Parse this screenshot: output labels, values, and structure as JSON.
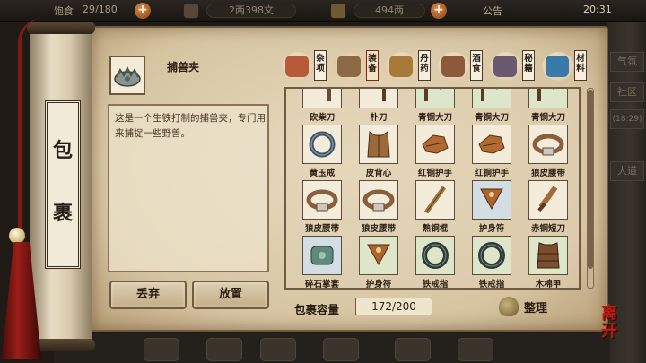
{
  "topbar": {
    "food_label": "饱食",
    "food_value": "29/180",
    "copper": "2两398文",
    "silver": "494两",
    "announcement": "公告",
    "time": "20:31"
  },
  "scroll": {
    "char1": "包",
    "char2": "裹"
  },
  "side_labels": [
    "气氛",
    "社区",
    "(18:29)",
    "大道"
  ],
  "selected_item": {
    "name": "捕兽夹",
    "description": "这是一个生铁打制的捕兽夹，专门用来捕捉一些野兽。"
  },
  "actions": {
    "discard": "丢弃",
    "place": "放置"
  },
  "tabs": [
    {
      "label": "杂项",
      "icon": "misc-pot-icon",
      "active": false
    },
    {
      "label": "装备",
      "icon": "equipment-icon",
      "active": true
    },
    {
      "label": "丹药",
      "icon": "pill-icon",
      "active": false
    },
    {
      "label": "酒食",
      "icon": "wine-food-icon",
      "active": false
    },
    {
      "label": "秘籍",
      "icon": "manual-books-icon",
      "active": false
    },
    {
      "label": "材料",
      "icon": "material-crystal-icon",
      "active": false
    }
  ],
  "items": [
    {
      "label": "砍柴刀",
      "icon": "chopping-knife-icon",
      "tier": "common"
    },
    {
      "label": "朴刀",
      "icon": "broadsword-icon",
      "tier": "common"
    },
    {
      "label": "青铜大刀",
      "icon": "bronze-blade-icon",
      "tier": "uncommon"
    },
    {
      "label": "青铜大刀",
      "icon": "bronze-blade-icon",
      "tier": "uncommon"
    },
    {
      "label": "青铜大刀",
      "icon": "bronze-blade-icon",
      "tier": "uncommon"
    },
    {
      "label": "黄玉戒",
      "icon": "topaz-ring-icon",
      "tier": "common"
    },
    {
      "label": "皮背心",
      "icon": "leather-vest-icon",
      "tier": "common"
    },
    {
      "label": "红铜护手",
      "icon": "copper-gauntlet-icon",
      "tier": "common"
    },
    {
      "label": "红铜护手",
      "icon": "copper-gauntlet-icon",
      "tier": "common"
    },
    {
      "label": "狼皮腰带",
      "icon": "wolf-belt-icon",
      "tier": "common"
    },
    {
      "label": "狼皮腰带",
      "icon": "wolf-belt-icon",
      "tier": "common"
    },
    {
      "label": "狼皮腰带",
      "icon": "wolf-belt-icon",
      "tier": "common"
    },
    {
      "label": "熟铜棍",
      "icon": "bronze-staff-icon",
      "tier": "common"
    },
    {
      "label": "护身符",
      "icon": "amulet-icon",
      "tier": "rare"
    },
    {
      "label": "赤铜短刀",
      "icon": "red-copper-dagger-icon",
      "tier": "common"
    },
    {
      "label": "碎石掌套",
      "icon": "stone-gauntlet-icon",
      "tier": "rare"
    },
    {
      "label": "护身符",
      "icon": "amulet-icon",
      "tier": "uncommon"
    },
    {
      "label": "铁戒指",
      "icon": "iron-ring-icon",
      "tier": "uncommon"
    },
    {
      "label": "铁戒指",
      "icon": "iron-ring-icon",
      "tier": "uncommon"
    },
    {
      "label": "木棉甲",
      "icon": "kapok-armor-icon",
      "tier": "uncommon"
    }
  ],
  "capacity": {
    "label": "包裹容量",
    "value": "172/200"
  },
  "sort": {
    "label": "整理"
  },
  "leave": {
    "label": "离开"
  }
}
